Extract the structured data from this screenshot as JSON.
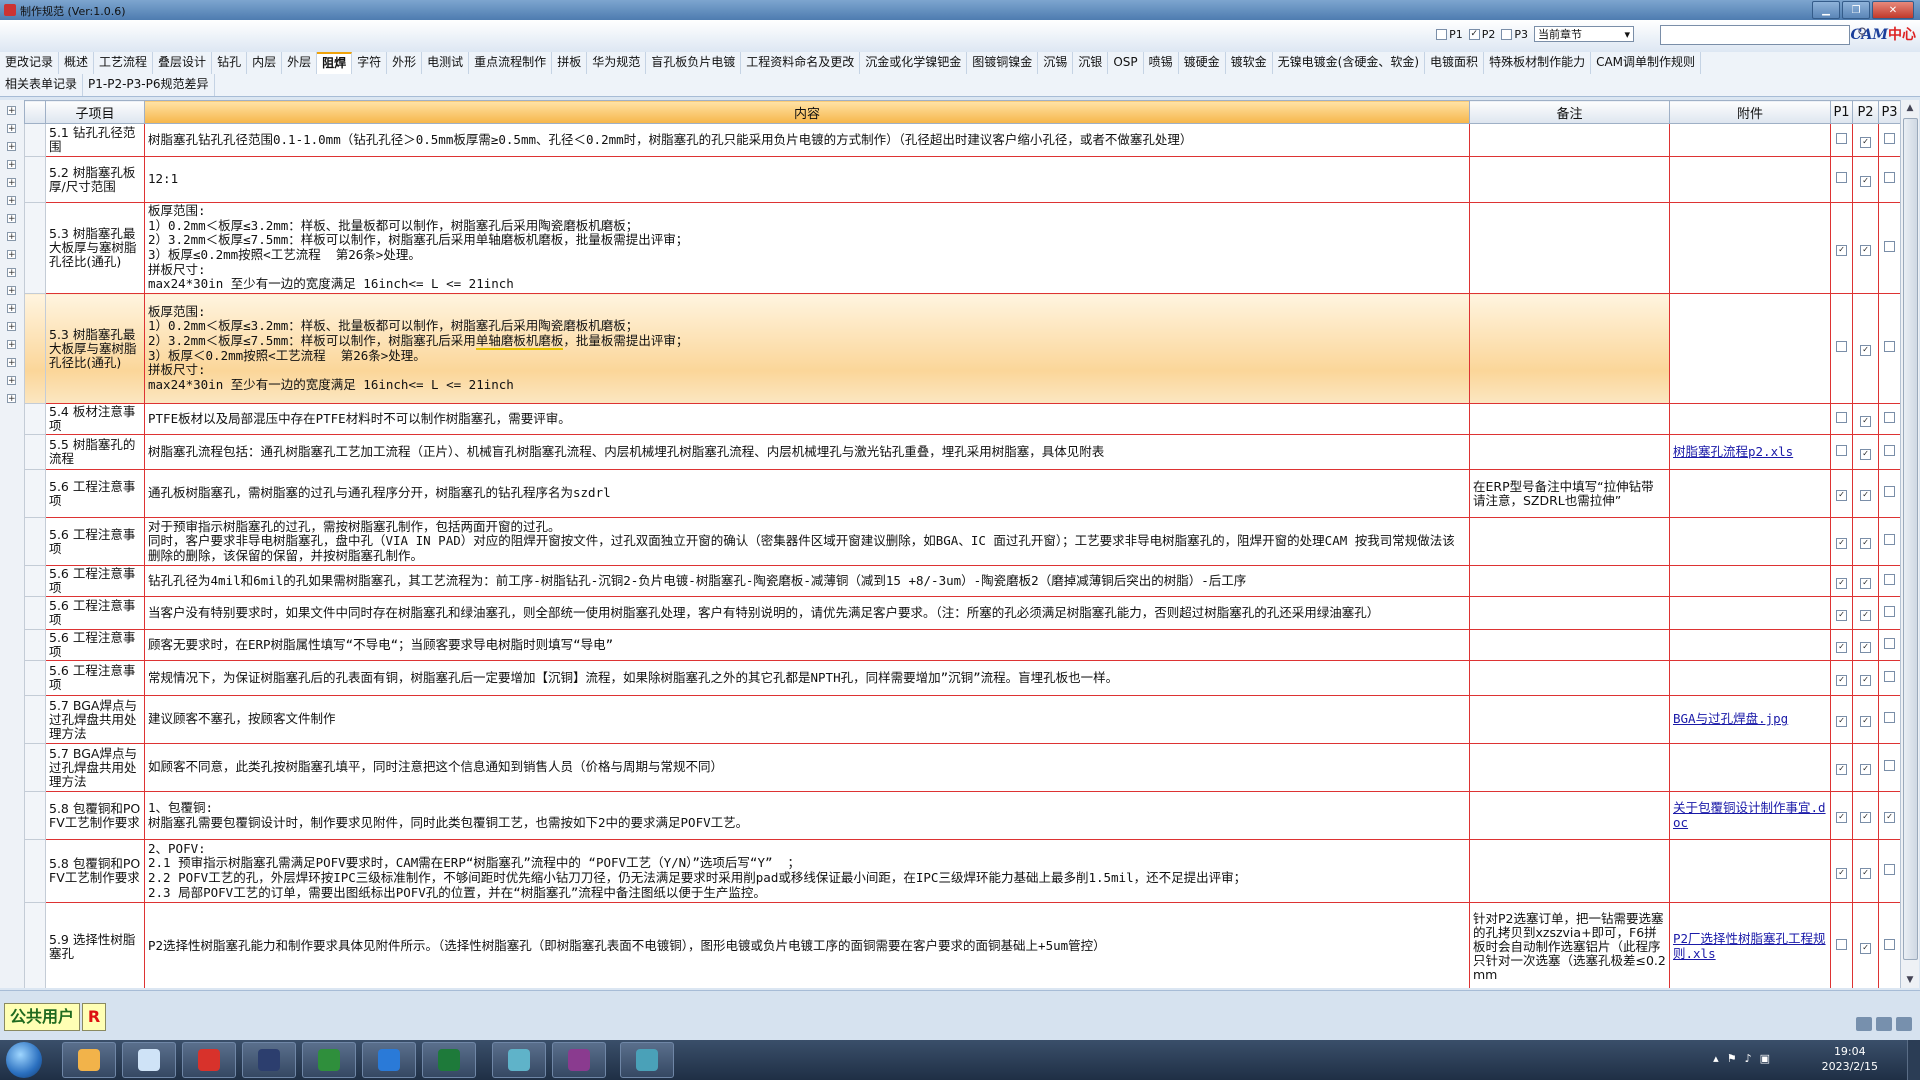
{
  "window": {
    "title": "制作规范 (Ver:1.0.6)",
    "min": "▁",
    "max": "❐",
    "close": "✕"
  },
  "toolbar": {
    "p1": "P1",
    "p2": "P2",
    "p3": "P3",
    "chapter_select": "当前章节",
    "chapter_arrow": "▾",
    "search_value": "",
    "search_icon": "⚲",
    "logo_text": "CAM",
    "logo_suffix": "中心"
  },
  "tabs_row1": [
    "更改记录",
    "概述",
    "工艺流程",
    "叠层设计",
    "钻孔",
    "内层",
    "外层",
    "阻焊",
    "字符",
    "外形",
    "电测试",
    "重点流程制作",
    "拼板",
    "华为规范",
    "盲孔板负片电镀",
    "工程资料命名及更改",
    "沉金或化学镍钯金",
    "图镀铜镍金",
    "沉锡",
    "沉银",
    "OSP",
    "喷锡",
    "镀硬金",
    "镀软金",
    "无镍电镀金(含硬金、软金)",
    "电镀面积",
    "特殊板材制作能力",
    "CAM调单制作规则"
  ],
  "active_tab": "阻焊",
  "tabs_row2": [
    "相关表单记录",
    "P1-P2-P3-P6规范差异"
  ],
  "columns": {
    "sub": "子项目",
    "content": "内容",
    "remark": "备注",
    "attach": "附件",
    "p1": "P1",
    "p2": "P2",
    "p3": "P3"
  },
  "rows": [
    {
      "sub": "5.1 钻孔孔径范围",
      "content": "树脂塞孔钻孔孔径范围0.1-1.0mm（钻孔孔径＞0.5mm板厚需≥0.5mm、孔径＜0.2mm时，树脂塞孔的孔只能采用负片电镀的方式制作）（孔径超出时建议客户缩小孔径，或者不做塞孔处理）",
      "remark": "",
      "attach": "",
      "p1": false,
      "p2": true,
      "p3": false
    },
    {
      "sub": "5.2 树脂塞孔板厚/尺寸范围",
      "content": "12:1",
      "remark": "",
      "attach": "",
      "p1": false,
      "p2": true,
      "p3": false
    },
    {
      "sub": "5.3 树脂塞孔最大板厚与塞树脂孔径比(通孔)",
      "content": "板厚范围:\n1）0.2mm＜板厚≤3.2mm：样板、批量板都可以制作，树脂塞孔后采用陶瓷磨板机磨板；\n2）3.2mm＜板厚≤7.5mm：样板可以制作，树脂塞孔后采用单轴磨板机磨板，批量板需提出评审；\n3）板厚≤0.2mm按照<工艺流程  第26条>处理。\n拼板尺寸:\nmax24*30in 至少有一边的宽度满足 16inch<= L <= 21inch",
      "remark": "",
      "attach": "",
      "p1": true,
      "p2": true,
      "p3": false
    },
    {
      "sub": "5.3 树脂塞孔最大板厚与塞树脂孔径比(通孔)",
      "content": "板厚范围:\n1）0.2mm＜板厚≤3.2mm：样板、批量板都可以制作，树脂塞孔后采用陶瓷磨板机磨板；\n2）3.2mm＜板厚≤7.5mm：样板可以制作，树脂塞孔后采用单轴磨板机磨板，批量板需提出评审；\n3）板厚＜0.2mm按照<工艺流程  第26条>处理。\n拼板尺寸:\nmax24*30in 至少有一边的宽度满足 16inch<= L <= 21inch",
      "remark": "",
      "attach": "",
      "p1": false,
      "p2": true,
      "p3": false
    },
    {
      "sub": "5.4 板材注意事项",
      "content": "PTFE板材以及局部混压中存在PTFE材料时不可以制作树脂塞孔，需要评审。",
      "remark": "",
      "attach": "",
      "p1": false,
      "p2": true,
      "p3": false
    },
    {
      "sub": "5.5 树脂塞孔的流程",
      "content": "树脂塞孔流程包括：通孔树脂塞孔工艺加工流程（正片）、机械盲孔树脂塞孔流程、内层机械埋孔树脂塞孔流程、内层机械埋孔与激光钻孔重叠，埋孔采用树脂塞，具体见附表",
      "remark": "",
      "attach": "树脂塞孔流程p2.xls",
      "p1": false,
      "p2": true,
      "p3": false
    },
    {
      "sub": "5.6 工程注意事项",
      "content": "通孔板树脂塞孔，需树脂塞的过孔与通孔程序分开，树脂塞孔的钻孔程序名为szdrl",
      "remark": "在ERP型号备注中填写“拉伸钻带请注意，SZDRL也需拉伸”",
      "attach": "",
      "p1": true,
      "p2": true,
      "p3": false
    },
    {
      "sub": "5.6 工程注意事项",
      "content": "对于预审指示树脂塞孔的过孔，需按树脂塞孔制作，包括两面开窗的过孔。\n同时，客户要求非导电树脂塞孔，盘中孔（VIA IN PAD）对应的阻焊开窗按文件，过孔双面独立开窗的确认（密集器件区域开窗建议删除，如BGA、IC 面过孔开窗）；工艺要求非导电树脂塞孔的，阻焊开窗的处理CAM 按我司常规做法该删除的删除，该保留的保留，并按树脂塞孔制作。",
      "remark": "",
      "attach": "",
      "p1": true,
      "p2": true,
      "p3": false
    },
    {
      "sub": "5.6 工程注意事项",
      "content": "钻孔孔径为4mil和6mil的孔如果需树脂塞孔，其工艺流程为：前工序-树脂钻孔-沉铜2-负片电镀-树脂塞孔-陶瓷磨板-减薄铜（减到15 +8/-3um）-陶瓷磨板2（磨掉减薄铜后突出的树脂）-后工序",
      "remark": "",
      "attach": "",
      "p1": true,
      "p2": true,
      "p3": false
    },
    {
      "sub": "5.6 工程注意事项",
      "content": "当客户没有特别要求时，如果文件中同时存在树脂塞孔和绿油塞孔，则全部统一使用树脂塞孔处理，客户有特别说明的，请优先满足客户要求。（注：所塞的孔必须满足树脂塞孔能力，否则超过树脂塞孔的孔还采用绿油塞孔）",
      "remark": "",
      "attach": "",
      "p1": true,
      "p2": true,
      "p3": false
    },
    {
      "sub": "5.6 工程注意事项",
      "content": "顾客无要求时，在ERP树脂属性填写“不导电“；当顾客要求导电树脂时则填写“导电”",
      "remark": "",
      "attach": "",
      "p1": true,
      "p2": true,
      "p3": false
    },
    {
      "sub": "5.6 工程注意事项",
      "content": "常规情况下，为保证树脂塞孔后的孔表面有铜，树脂塞孔后一定要增加【沉铜】流程，如果除树脂塞孔之外的其它孔都是NPTH孔，同样需要增加”沉铜”流程。盲埋孔板也一样。",
      "remark": "",
      "attach": "",
      "p1": true,
      "p2": true,
      "p3": false
    },
    {
      "sub": "5.7 BGA焊点与过孔焊盘共用处理方法",
      "content": "建议顾客不塞孔，按顾客文件制作",
      "remark": "",
      "attach": "BGA与过孔焊盘.jpg",
      "p1": true,
      "p2": true,
      "p3": false
    },
    {
      "sub": "5.7 BGA焊点与过孔焊盘共用处理方法",
      "content": "如顾客不同意，此类孔按树脂塞孔填平，同时注意把这个信息通知到销售人员（价格与周期与常规不同）",
      "remark": "",
      "attach": "",
      "p1": true,
      "p2": true,
      "p3": false
    },
    {
      "sub": "5.8 包覆铜和POFV工艺制作要求",
      "content": "1、包覆铜:\n树脂塞孔需要包覆铜设计时，制作要求见附件，同时此类包覆铜工艺，也需按如下2中的要求满足POFV工艺。",
      "remark": "",
      "attach": "关于包覆铜设计制作事宜.doc",
      "p1": true,
      "p2": true,
      "p3": true
    },
    {
      "sub": "5.8 包覆铜和POFV工艺制作要求",
      "content": "2、POFV:\n2.1 预审指示树脂塞孔需满足POFV要求时，CAM需在ERP“树脂塞孔”流程中的 “POFV工艺（Y/N）”选项后写“Y”  ；\n2.2 POFV工艺的孔，外层焊环按IPC三级标准制作，不够间距时优先缩小钻刀刀径，仍无法满足要求时采用削pad或移线保证最小间距，在IPC三级焊环能力基础上最多削1.5mil，还不足提出评审；\n2.3 局部POFV工艺的订单，需要出图纸标出POFV孔的位置，并在“树脂塞孔”流程中备注图纸以便于生产监控。",
      "remark": "",
      "attach": "",
      "p1": true,
      "p2": true,
      "p3": false
    },
    {
      "sub": "5.9 选择性树脂塞孔",
      "content": "P2选择性树脂塞孔能力和制作要求具体见附件所示。（选择性树脂塞孔（即树脂塞孔表面不电镀铜），图形电镀或负片电镀工序的面铜需要在客户要求的面铜基础上+5um管控）",
      "remark": "针对P2选塞订单，把一钻需要选塞的孔拷贝到xzszvia+即可，F6拼板时会自动制作选塞铝片（此程序只针对一次选塞（选塞孔极差≤0.2mm",
      "attach": "P2厂选择性树脂塞孔工程规则.xls",
      "p1": false,
      "p2": true,
      "p3": false
    }
  ],
  "selected_row_index": 3,
  "status": {
    "user": "公共用户",
    "badge": "R"
  },
  "taskbar": {
    "time": "19:04",
    "date": "2023/2/15"
  }
}
